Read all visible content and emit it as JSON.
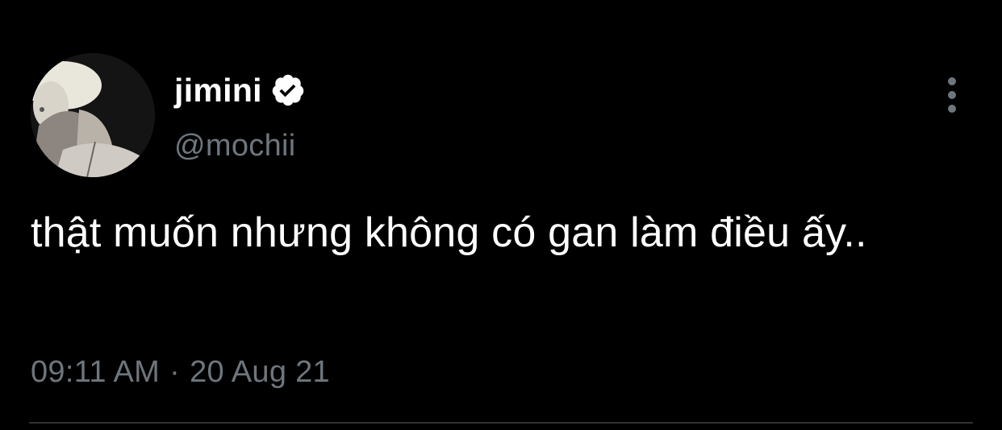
{
  "user": {
    "display_name": "jimini",
    "handle": "@mochii",
    "verified": true,
    "avatar_icon": "profile-photo"
  },
  "tweet": {
    "text": "thật muốn nhưng không có gan làm điều ấy..",
    "time": "09:11 AM",
    "separator": "·",
    "date": "20 Aug 21"
  },
  "icons": {
    "verified": "verified-badge-icon",
    "more": "more-options-icon"
  },
  "colors": {
    "background": "#000000",
    "text": "#ffffff",
    "secondary": "#6e767d",
    "divider": "#2f3336"
  }
}
